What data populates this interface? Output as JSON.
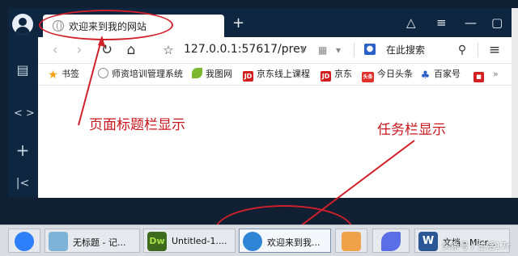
{
  "browser": {
    "tab_title": "欢迎来到我的网站",
    "new_tab_symbol": "+",
    "url": "127.0.0.1:57617/prev",
    "search_label": "在此搜索"
  },
  "bookmarks": [
    {
      "label": "书签",
      "icon": "star-icon",
      "color": "#f0a010"
    },
    {
      "label": "师资培训管理系统",
      "icon": "globe-icon",
      "color": "#888888"
    },
    {
      "label": "我图网",
      "icon": "leaf-icon",
      "color": "#7cb82f"
    },
    {
      "label": "京东线上课程",
      "icon": "jd-icon",
      "color": "#d21e1e",
      "badge": "JD"
    },
    {
      "label": "京东",
      "icon": "jd-icon",
      "color": "#d21e1e",
      "badge": "JD"
    },
    {
      "label": "今日头条",
      "icon": "toutiao-icon",
      "color": "#e0302c",
      "badge": "头条"
    },
    {
      "label": "百家号",
      "icon": "paw-icon",
      "color": "#2a60c8"
    }
  ],
  "annotations": {
    "title_bar": "页面标题栏显示",
    "taskbar": "任务栏显示"
  },
  "taskbar": {
    "items": [
      {
        "label": "",
        "icon": "baidu-netdisk-icon",
        "color": "#2d7ff9"
      },
      {
        "label": "无标题 - 记...",
        "icon": "notepad-icon",
        "color": "#7fb2d8"
      },
      {
        "label": "Untitled-1....",
        "icon": "dreamweaver-icon",
        "color": "#3d6b1e",
        "badge": "Dw"
      },
      {
        "label": "欢迎来到我...",
        "icon": "browser-icon",
        "color": "#2f86d6"
      },
      {
        "label": "",
        "icon": "app-k-icon",
        "color": "#f0a24a"
      },
      {
        "label": "",
        "icon": "feishu-icon",
        "color": "#5a6ee6"
      },
      {
        "label": "文档 - Micr...",
        "icon": "word-icon",
        "color": "#2b5797",
        "badge": "W"
      }
    ]
  },
  "watermark": "头条号 / 生活17r"
}
